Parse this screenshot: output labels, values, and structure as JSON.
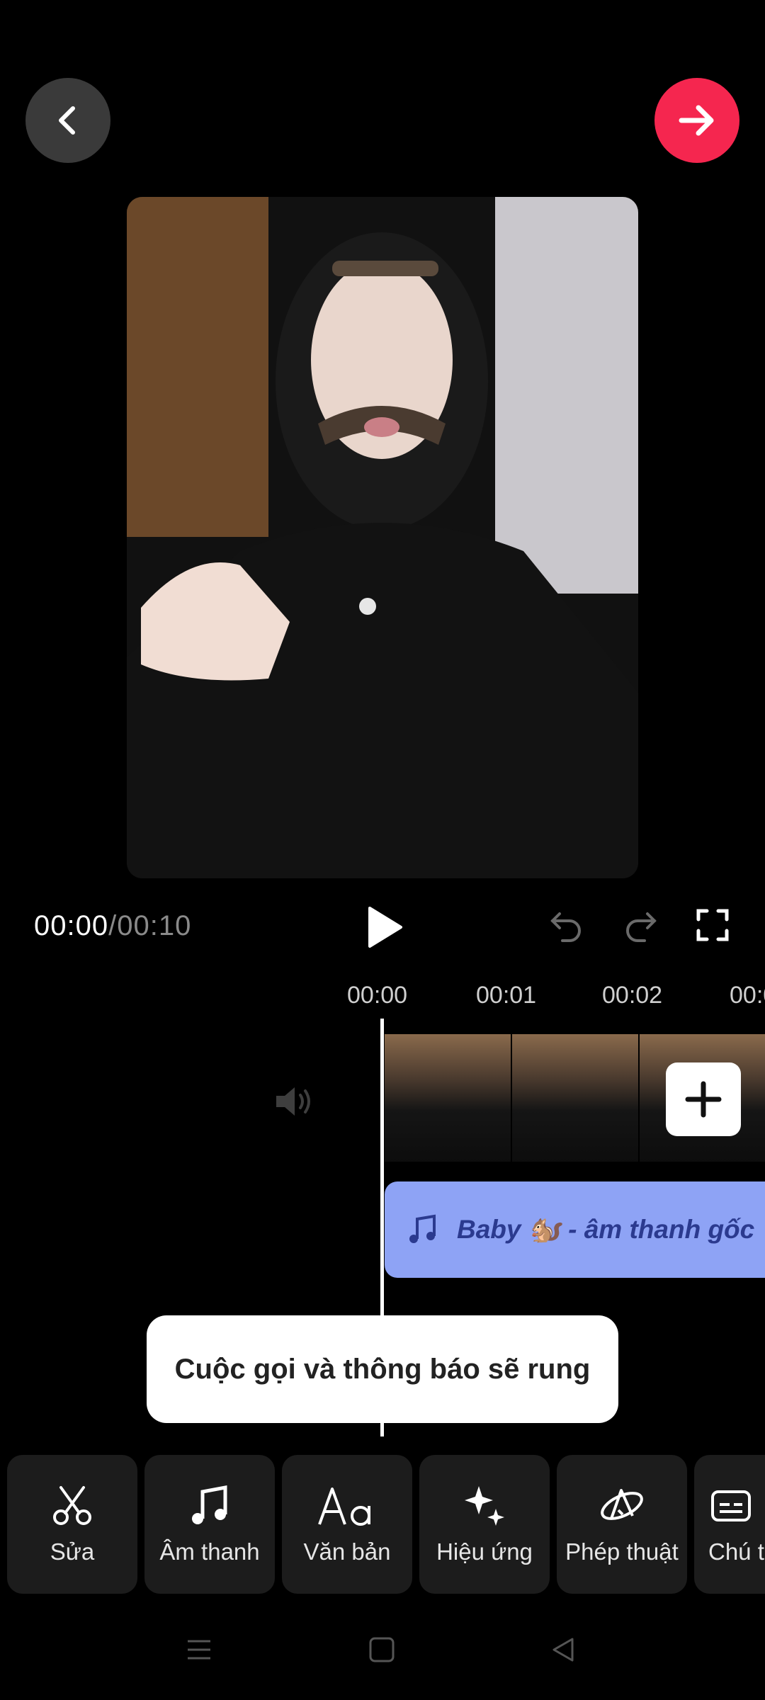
{
  "header": {
    "back_icon": "chevron-left-icon",
    "next_icon": "arrow-right-icon",
    "next_color": "#f5264f"
  },
  "player": {
    "current_time": "00:00",
    "separator": "/",
    "total_time": "00:10"
  },
  "timeline": {
    "ruler": [
      "00:00",
      "00:01",
      "00:02",
      "00:0"
    ]
  },
  "audio_track": {
    "title": "Baby 🐿️ - âm thanh gốc"
  },
  "toast": {
    "text": "Cuộc gọi và thông báo sẽ rung"
  },
  "toolbar": {
    "items": [
      {
        "label": "Sửa",
        "icon": "scissors-icon"
      },
      {
        "label": "Âm thanh",
        "icon": "music-note-icon"
      },
      {
        "label": "Văn bản",
        "icon": "text-icon"
      },
      {
        "label": "Hiệu ứng",
        "icon": "sparkles-icon"
      },
      {
        "label": "Phép thuật",
        "icon": "magic-icon"
      },
      {
        "label": "Chú t",
        "icon": "caption-icon"
      }
    ]
  },
  "colors": {
    "audio_track": "#8ea3f5",
    "toolbar_bg": "#1c1c1c"
  }
}
